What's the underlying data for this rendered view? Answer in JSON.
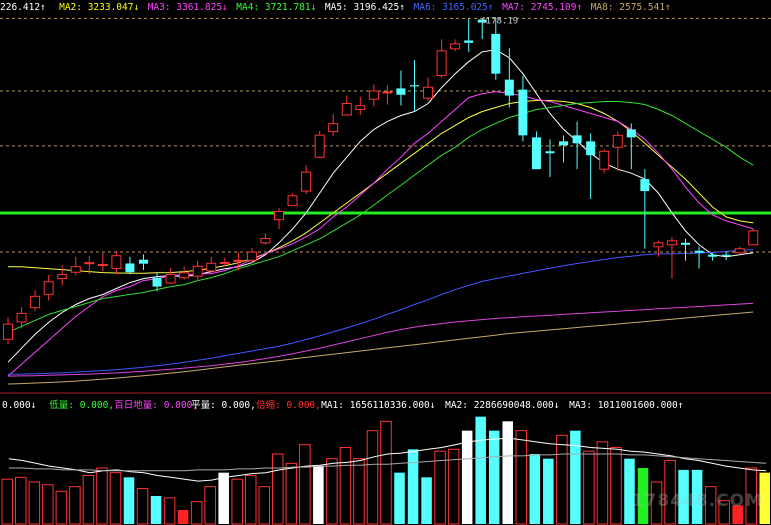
{
  "chart_data": {
    "type": "candlestick",
    "price_legend": [
      {
        "label": "",
        "value": "226.412",
        "arrow": "↑",
        "color": "#ffffff"
      },
      {
        "label": "MA2:",
        "value": "3233.047",
        "arrow": "↓",
        "color": "#ffff00"
      },
      {
        "label": "MA3:",
        "value": "3361.825",
        "arrow": "↓",
        "color": "#ff44ff"
      },
      {
        "label": "MA4:",
        "value": "3721.781",
        "arrow": "↓",
        "color": "#33ff33"
      },
      {
        "label": "MA5:",
        "value": "3196.425",
        "arrow": "↑",
        "color": "#ffffff"
      },
      {
        "label": "MA6:",
        "value": "3165.025",
        "arrow": "↑",
        "color": "#4466ff"
      },
      {
        "label": "MA7:",
        "value": "2745.109",
        "arrow": "↑",
        "color": "#ff44ff"
      },
      {
        "label": "MA8:",
        "value": "2575.541",
        "arrow": "↑",
        "color": "#c8a868"
      }
    ],
    "peak_label": "4178.19",
    "volume_legend": [
      {
        "label": "",
        "value": "0.000",
        "arrow": "↓",
        "color": "#ffffff"
      },
      {
        "label": "低量:",
        "value": "0.000,",
        "arrow": "",
        "color": "#33ff33"
      },
      {
        "label": "百日地量:",
        "value": "0.000,",
        "arrow": "",
        "color": "#ff44ff"
      },
      {
        "label": "平量:",
        "value": "0.000,",
        "arrow": "",
        "color": "#ffffff"
      },
      {
        "label": "倍缩:",
        "value": "0.000,",
        "arrow": "",
        "color": "#ff3333"
      },
      {
        "label": "MA1:",
        "value": "1656110336.000",
        "arrow": "↓",
        "color": "#ffffff"
      },
      {
        "label": "MA2:",
        "value": "2286690048.000",
        "arrow": "↓",
        "color": "#ffffff"
      },
      {
        "label": "MA3:",
        "value": "1011001600.000",
        "arrow": "↑",
        "color": "#ffffff"
      }
    ],
    "price_ylim": [
      2300,
      4200
    ],
    "support_line": 3200,
    "dashed_levels": [
      4178,
      3813,
      3537,
      3004
    ],
    "candles": [
      [
        2565,
        2641,
        2540,
        2675
      ],
      [
        2652,
        2695,
        2620,
        2726
      ],
      [
        2724,
        2781,
        2705,
        2811
      ],
      [
        2791,
        2854,
        2760,
        2887
      ],
      [
        2870,
        2890,
        2836,
        2937
      ],
      [
        2902,
        2930,
        2886,
        2980
      ],
      [
        2946,
        2950,
        2893,
        2985
      ],
      [
        2940,
        2941,
        2907,
        2999
      ],
      [
        2921,
        2985,
        2891,
        3009
      ],
      [
        2946,
        2902,
        2891,
        2980
      ],
      [
        2965,
        2945,
        2913,
        2992
      ],
      [
        2874,
        2830,
        2806,
        2902
      ],
      [
        2848,
        2891,
        2843,
        2923
      ],
      [
        2874,
        2899,
        2865,
        2930
      ],
      [
        2882,
        2932,
        2857,
        2960
      ],
      [
        2909,
        2947,
        2895,
        2980
      ],
      [
        2946,
        2951,
        2931,
        2975
      ],
      [
        2957,
        2962,
        2911,
        3003
      ],
      [
        2962,
        3003,
        2950,
        3025
      ],
      [
        3050,
        3072,
        3041,
        3098
      ],
      [
        3166,
        3207,
        3119,
        3224
      ],
      [
        3237,
        3286,
        3235,
        3299
      ],
      [
        3310,
        3405,
        3294,
        3440
      ],
      [
        3480,
        3591,
        3476,
        3612
      ],
      [
        3609,
        3649,
        3587,
        3697
      ],
      [
        3692,
        3750,
        3689,
        3791
      ],
      [
        3720,
        3739,
        3692,
        3784
      ],
      [
        3772,
        3813,
        3735,
        3845
      ],
      [
        3808,
        3808,
        3745,
        3842
      ],
      [
        3826,
        3794,
        3740,
        3916
      ],
      [
        3842,
        3836,
        3710,
        3969
      ],
      [
        3777,
        3832,
        3763,
        3881
      ],
      [
        3891,
        4015,
        3881,
        4073
      ],
      [
        4025,
        4050,
        4014,
        4072
      ],
      [
        4067,
        4055,
        4008,
        4178
      ],
      [
        4172,
        4157,
        4074,
        4178
      ],
      [
        4100,
        3900,
        3870,
        4178
      ],
      [
        3870,
        3790,
        3730,
        4028
      ],
      [
        3820,
        3590,
        3560,
        3890
      ],
      [
        3580,
        3420,
        3450,
        3610
      ],
      [
        3510,
        3500,
        3380,
        3570
      ],
      [
        3560,
        3540,
        3454,
        3590
      ],
      [
        3590,
        3550,
        3420,
        3659
      ],
      [
        3560,
        3490,
        3270,
        3600
      ],
      [
        3420,
        3510,
        3400,
        3520
      ],
      [
        3530,
        3590,
        3410,
        3610
      ],
      [
        3620,
        3580,
        3420,
        3650
      ],
      [
        3370,
        3310,
        3020,
        3420
      ],
      [
        3030,
        3050,
        2980,
        3060
      ],
      [
        3040,
        3060,
        2870,
        3080
      ],
      [
        3050,
        3040,
        2960,
        3070
      ],
      [
        3010,
        3000,
        2920,
        3030
      ],
      [
        2990,
        2980,
        2960,
        3000
      ],
      [
        2990,
        2984,
        2963,
        3006
      ],
      [
        3000,
        3020,
        2990,
        3030
      ],
      [
        3040,
        3110,
        3040,
        3120
      ]
    ],
    "ma_lines": {
      "ma_white": [
        2450,
        2520,
        2590,
        2650,
        2700,
        2740,
        2770,
        2790,
        2820,
        2850,
        2870,
        2880,
        2885,
        2880,
        2890,
        2905,
        2920,
        2930,
        2950,
        2990,
        3050,
        3120,
        3200,
        3300,
        3400,
        3480,
        3560,
        3620,
        3660,
        3690,
        3710,
        3750,
        3830,
        3900,
        3960,
        4010,
        4020,
        3980,
        3900,
        3800,
        3700,
        3620,
        3560,
        3500,
        3450,
        3420,
        3400,
        3370,
        3300,
        3200,
        3110,
        3040,
        2990,
        2980,
        2990,
        3000
      ],
      "ma_yellow": [
        2930,
        2930,
        2925,
        2920,
        2915,
        2910,
        2905,
        2900,
        2898,
        2897,
        2897,
        2899,
        2900,
        2905,
        2912,
        2922,
        2935,
        2950,
        2970,
        2995,
        3025,
        3060,
        3100,
        3150,
        3200,
        3250,
        3300,
        3350,
        3400,
        3450,
        3500,
        3550,
        3600,
        3640,
        3680,
        3710,
        3730,
        3750,
        3760,
        3765,
        3765,
        3760,
        3750,
        3730,
        3700,
        3660,
        3610,
        3550,
        3490,
        3430,
        3370,
        3300,
        3230,
        3180,
        3160,
        3150
      ],
      "ma_magenta": [
        2380,
        2440,
        2500,
        2560,
        2620,
        2680,
        2730,
        2780,
        2810,
        2830,
        2860,
        2870,
        2885,
        2890,
        2893,
        2895,
        2910,
        2935,
        2965,
        2995,
        3020,
        3045,
        3080,
        3120,
        3180,
        3230,
        3290,
        3350,
        3420,
        3480,
        3550,
        3600,
        3660,
        3720,
        3780,
        3800,
        3810,
        3800,
        3790,
        3770,
        3760,
        3740,
        3720,
        3700,
        3680,
        3660,
        3620,
        3570,
        3500,
        3420,
        3330,
        3250,
        3190,
        3160,
        3140,
        3120
      ],
      "ma_green": [
        2600,
        2630,
        2660,
        2690,
        2710,
        2730,
        2750,
        2770,
        2780,
        2790,
        2800,
        2815,
        2830,
        2840,
        2860,
        2875,
        2895,
        2920,
        2940,
        2960,
        2980,
        3010,
        3040,
        3070,
        3110,
        3150,
        3190,
        3240,
        3290,
        3340,
        3390,
        3440,
        3490,
        3530,
        3580,
        3620,
        3650,
        3680,
        3700,
        3720,
        3730,
        3740,
        3750,
        3755,
        3760,
        3760,
        3755,
        3745,
        3720,
        3690,
        3650,
        3610,
        3570,
        3530,
        3480,
        3440
      ],
      "ma_blue": [
        2390,
        2390,
        2392,
        2394,
        2396,
        2400,
        2404,
        2408,
        2412,
        2418,
        2424,
        2432,
        2440,
        2450,
        2460,
        2470,
        2482,
        2494,
        2506,
        2518,
        2530,
        2546,
        2564,
        2582,
        2602,
        2622,
        2644,
        2666,
        2690,
        2714,
        2740,
        2764,
        2790,
        2814,
        2836,
        2856,
        2870,
        2883,
        2896,
        2909,
        2922,
        2935,
        2946,
        2956,
        2966,
        2976,
        2982,
        2990,
        2994,
        2994,
        2996,
        2998,
        3001,
        3006,
        3012,
        3016
      ],
      "ma_pink": [
        2380,
        2381,
        2382,
        2384,
        2386,
        2388,
        2390,
        2393,
        2396,
        2400,
        2404,
        2409,
        2414,
        2420,
        2426,
        2432,
        2440,
        2448,
        2458,
        2468,
        2480,
        2492,
        2506,
        2520,
        2536,
        2552,
        2568,
        2584,
        2600,
        2614,
        2626,
        2636,
        2644,
        2652,
        2658,
        2664,
        2670,
        2674,
        2678,
        2682,
        2686,
        2690,
        2694,
        2698,
        2702,
        2706,
        2710,
        2714,
        2718,
        2722,
        2726,
        2730,
        2734,
        2738,
        2742,
        2746
      ],
      "ma_tan": [
        2340,
        2342,
        2345,
        2348,
        2351,
        2355,
        2360,
        2365,
        2370,
        2376,
        2382,
        2388,
        2395,
        2402,
        2410,
        2418,
        2426,
        2434,
        2442,
        2450,
        2458,
        2466,
        2474,
        2482,
        2490,
        2498,
        2506,
        2514,
        2522,
        2530,
        2538,
        2546,
        2554,
        2562,
        2570,
        2578,
        2586,
        2594,
        2600,
        2606,
        2612,
        2618,
        2624,
        2630,
        2636,
        2642,
        2648,
        2654,
        2660,
        2666,
        2672,
        2678,
        2684,
        2690,
        2696,
        2702
      ]
    },
    "volume_ylim": [
      0,
      120
    ],
    "volumes": [
      [
        48,
        "hollow"
      ],
      [
        50,
        "hollow"
      ],
      [
        45,
        "hollow"
      ],
      [
        42,
        "hollow"
      ],
      [
        35,
        "hollow"
      ],
      [
        40,
        "hollow"
      ],
      [
        52,
        "hollow"
      ],
      [
        60,
        "hollow"
      ],
      [
        55,
        "hollow"
      ],
      [
        50,
        "cyan"
      ],
      [
        38,
        "hollow"
      ],
      [
        30,
        "cyan"
      ],
      [
        28,
        "hollow"
      ],
      [
        15,
        "red"
      ],
      [
        24,
        "hollow"
      ],
      [
        40,
        "hollow"
      ],
      [
        55,
        "white"
      ],
      [
        48,
        "hollow"
      ],
      [
        52,
        "hollow"
      ],
      [
        40,
        "hollow"
      ],
      [
        75,
        "hollow"
      ],
      [
        65,
        "hollow"
      ],
      [
        85,
        "hollow"
      ],
      [
        62,
        "white"
      ],
      [
        70,
        "hollow"
      ],
      [
        82,
        "hollow"
      ],
      [
        70,
        "hollow"
      ],
      [
        100,
        "hollow"
      ],
      [
        110,
        "hollow"
      ],
      [
        55,
        "cyan"
      ],
      [
        80,
        "cyan"
      ],
      [
        50,
        "cyan"
      ],
      [
        78,
        "hollow"
      ],
      [
        80,
        "hollow"
      ],
      [
        100,
        "white"
      ],
      [
        115,
        "cyan"
      ],
      [
        100,
        "cyan"
      ],
      [
        110,
        "white"
      ],
      [
        100,
        "hollow"
      ],
      [
        75,
        "cyan"
      ],
      [
        70,
        "cyan"
      ],
      [
        95,
        "hollow"
      ],
      [
        100,
        "cyan"
      ],
      [
        78,
        "hollow"
      ],
      [
        88,
        "hollow"
      ],
      [
        82,
        "hollow"
      ],
      [
        70,
        "cyan"
      ],
      [
        60,
        "green"
      ],
      [
        45,
        "hollow"
      ],
      [
        68,
        "hollow"
      ],
      [
        58,
        "cyan"
      ],
      [
        58,
        "cyan"
      ],
      [
        40,
        "hollow"
      ],
      [
        25,
        "hollow"
      ],
      [
        20,
        "red"
      ],
      [
        60,
        "hollow"
      ],
      [
        55,
        "yellow"
      ]
    ],
    "volume_ma": [
      70,
      68,
      65,
      62,
      60,
      58,
      55,
      57,
      58,
      56,
      55,
      52,
      50,
      48,
      46,
      47,
      50,
      52,
      54,
      55,
      58,
      60,
      62,
      63,
      65,
      66,
      68,
      72,
      75,
      76,
      78,
      80,
      82,
      85,
      88,
      90,
      91,
      92,
      90,
      88,
      86,
      85,
      84,
      82,
      81,
      80,
      78,
      77,
      75,
      73,
      70,
      68,
      65,
      62,
      60,
      58,
      57
    ],
    "volume_ma2": [
      60,
      60,
      59,
      59,
      58,
      58,
      58,
      57,
      57,
      57,
      57,
      57,
      57,
      57,
      58,
      58,
      58,
      59,
      59,
      60,
      60,
      61,
      61,
      62,
      62,
      63,
      63,
      64,
      64,
      65,
      66,
      67,
      68,
      69,
      70,
      71,
      72,
      73,
      73,
      74,
      74,
      75,
      75,
      75,
      75,
      75,
      74,
      74,
      73,
      72,
      71,
      70,
      69,
      68,
      67,
      66,
      65
    ]
  },
  "watermark": "178448.COM"
}
